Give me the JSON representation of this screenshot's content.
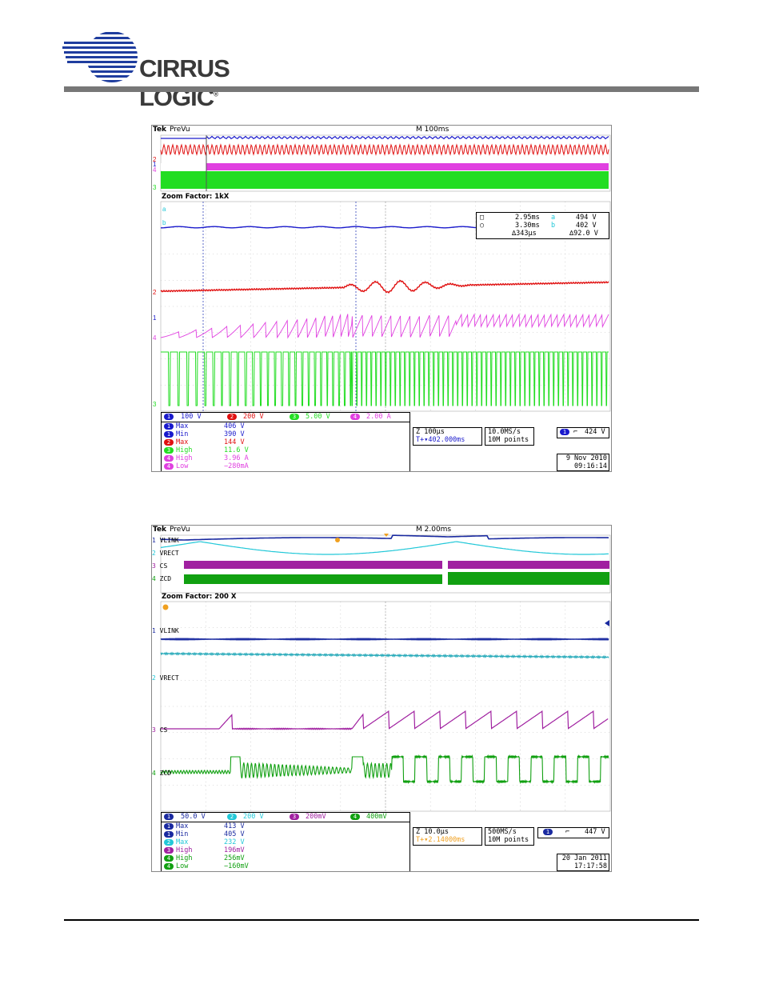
{
  "header": {
    "logo_text": "CIRRUS LOGIC",
    "logo_reg": "®"
  },
  "scope1": {
    "brand": "Tek",
    "mode": "PreVu",
    "timebase": "M 100ms",
    "zoom": "Zoom Factor: 1kX",
    "cursor_readout": {
      "row1_t": "2.95ms",
      "row1_v": "494 V",
      "row2_t": "3.30ms",
      "row2_v": "402 V",
      "row3_t": "∆343µs",
      "row3_v": "∆92.0 V",
      "cursor_a_label": "a",
      "cursor_b_label": "b"
    },
    "channels": [
      {
        "num": "1",
        "scale": "100 V",
        "color": "#1a1acc"
      },
      {
        "num": "2",
        "scale": "200 V",
        "color": "#e01010"
      },
      {
        "num": "3",
        "scale": "5.00 V",
        "color": "#22dd22"
      },
      {
        "num": "4",
        "scale": "2.00 A",
        "color": "#e040e0"
      }
    ],
    "measurements": [
      {
        "ch": "1",
        "name": "Max",
        "value": "406 V",
        "color": "#1a1acc"
      },
      {
        "ch": "1",
        "name": "Min",
        "value": "390 V",
        "color": "#1a1acc"
      },
      {
        "ch": "2",
        "name": "Max",
        "value": "144 V",
        "color": "#e01010"
      },
      {
        "ch": "3",
        "name": "High",
        "value": "11.6 V",
        "color": "#22dd22"
      },
      {
        "ch": "4",
        "name": "High",
        "value": "3.96 A",
        "color": "#e040e0"
      },
      {
        "ch": "4",
        "name": "Low",
        "value": "−280mA",
        "color": "#e040e0"
      }
    ],
    "zoom_time": "Z 100µs",
    "zoom_pos": "T+▾402.000ms",
    "sample_rate": "10.0MS/s",
    "points": "10M points",
    "trigger_ch": "1",
    "trigger_slope": "⌐",
    "trigger_level": "424 V",
    "date": "9 Nov 2010",
    "time": "09:16:14"
  },
  "scope2": {
    "brand": "Tek",
    "mode": "PreVu",
    "timebase": "M 2.00ms",
    "zoom": "Zoom Factor: 200 X",
    "trace_labels": [
      "VLINK",
      "VRECT",
      "CS",
      "ZCD"
    ],
    "channels": [
      {
        "num": "1",
        "scale": "50.0 V",
        "color": "#1a2aa0"
      },
      {
        "num": "2",
        "scale": "200 V",
        "color": "#22c8d8"
      },
      {
        "num": "3",
        "scale": "200mV",
        "color": "#a020a0"
      },
      {
        "num": "4",
        "scale": "400mV",
        "color": "#11a011"
      }
    ],
    "measurements": [
      {
        "ch": "1",
        "name": "Max",
        "value": "413 V",
        "color": "#1a2aa0"
      },
      {
        "ch": "1",
        "name": "Min",
        "value": "405 V",
        "color": "#1a2aa0"
      },
      {
        "ch": "2",
        "name": "Max",
        "value": "232 V",
        "color": "#22c8d8"
      },
      {
        "ch": "3",
        "name": "High",
        "value": "196mV",
        "color": "#a020a0"
      },
      {
        "ch": "4",
        "name": "High",
        "value": "256mV",
        "color": "#11a011"
      },
      {
        "ch": "4",
        "name": "Low",
        "value": "−160mV",
        "color": "#11a011"
      }
    ],
    "zoom_time": "Z 10.0µs",
    "zoom_pos": "T+▾2.14000ms",
    "sample_rate": "500MS/s",
    "points": "10M points",
    "trigger_ch": "1",
    "trigger_slope": "⌐",
    "trigger_level": "447 V",
    "date": "20 Jan  2011",
    "time": "17:17:58"
  }
}
